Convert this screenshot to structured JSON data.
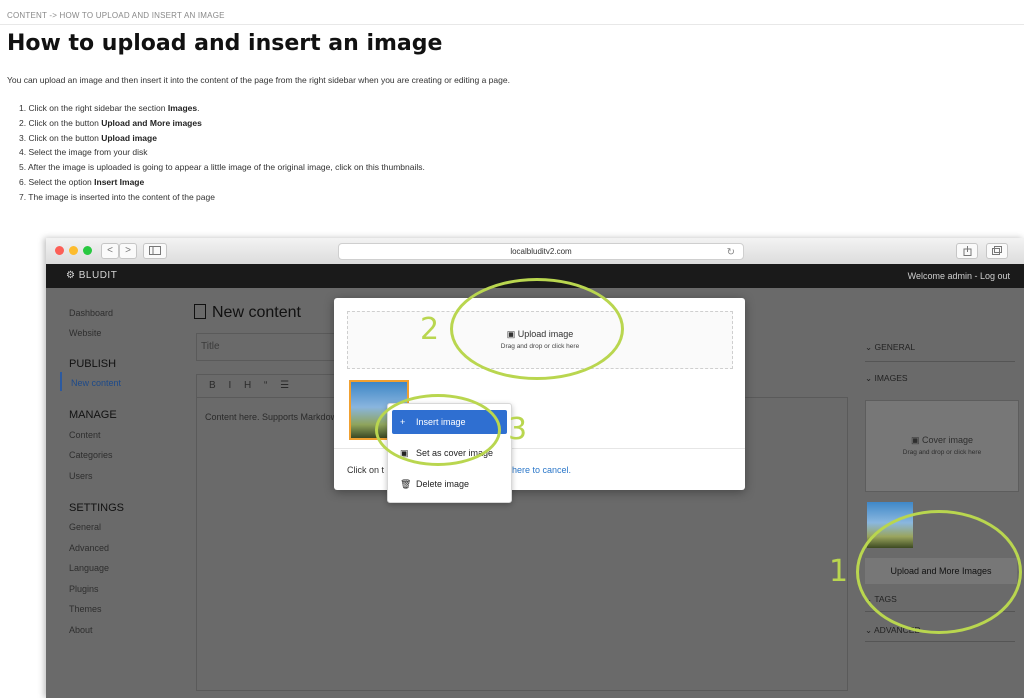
{
  "doc": {
    "breadcrumb": "CONTENT -> HOW TO UPLOAD AND INSERT AN IMAGE",
    "title": "How to upload and insert an image",
    "intro": "You can upload an image and then insert it into the content of the page from the right sidebar when you are creating or editing a page.",
    "steps": [
      {
        "text": "1. Click on the right sidebar the section ",
        "bold": "Images",
        "tail": "."
      },
      {
        "text": "2. Click on the button ",
        "bold": "Upload and More images",
        "tail": ""
      },
      {
        "text": "3. Click on the button ",
        "bold": "Upload image",
        "tail": ""
      },
      {
        "text": "4. Select the image from your disk",
        "bold": "",
        "tail": ""
      },
      {
        "text": "5. After the image is uploaded is going to appear a little image of the original image, click on this thumbnails.",
        "bold": "",
        "tail": ""
      },
      {
        "text": "6. Select the option ",
        "bold": "Insert Image",
        "tail": ""
      },
      {
        "text": "7. The image is inserted into the content of the page",
        "bold": "",
        "tail": ""
      }
    ]
  },
  "browser": {
    "url": "localbluditv2.com",
    "back": "<",
    "forward": ">"
  },
  "app": {
    "brand": "BLUDIT",
    "welcome": "Welcome admin - Log out",
    "sidebar": {
      "dashboard": "Dashboard",
      "website": "Website",
      "publish": "PUBLISH",
      "new_content": "New content",
      "manage": "MANAGE",
      "content": "Content",
      "categories": "Categories",
      "users": "Users",
      "settings": "SETTINGS",
      "general": "General",
      "advanced": "Advanced",
      "language": "Language",
      "plugins": "Plugins",
      "themes": "Themes",
      "about": "About"
    },
    "main": {
      "page_title": "New content",
      "title_placeholder": "Title",
      "toolbar": "B I H “ ☰",
      "editor_text": "Content here. Supports Markdown"
    },
    "right": {
      "general": "⌄ GENERAL",
      "images": "⌄ IMAGES",
      "cover_title": "Cover image",
      "cover_sub": "Drag and drop or click here",
      "upload_more": "Upload and More Images",
      "tags": "⌄ TAGS",
      "advanced": "⌄ ADVANCED"
    },
    "modal": {
      "upload_title": "Upload image",
      "upload_sub": "Drag and drop or click here",
      "footer": "Click on t",
      "cancel_link": "here to cancel."
    },
    "menu": {
      "insert": "Insert image",
      "cover": "Set as cover image",
      "delete": "Delete image"
    }
  },
  "annotations": {
    "one": "1",
    "two": "2",
    "three": "3",
    "color": "#b9d64f"
  }
}
